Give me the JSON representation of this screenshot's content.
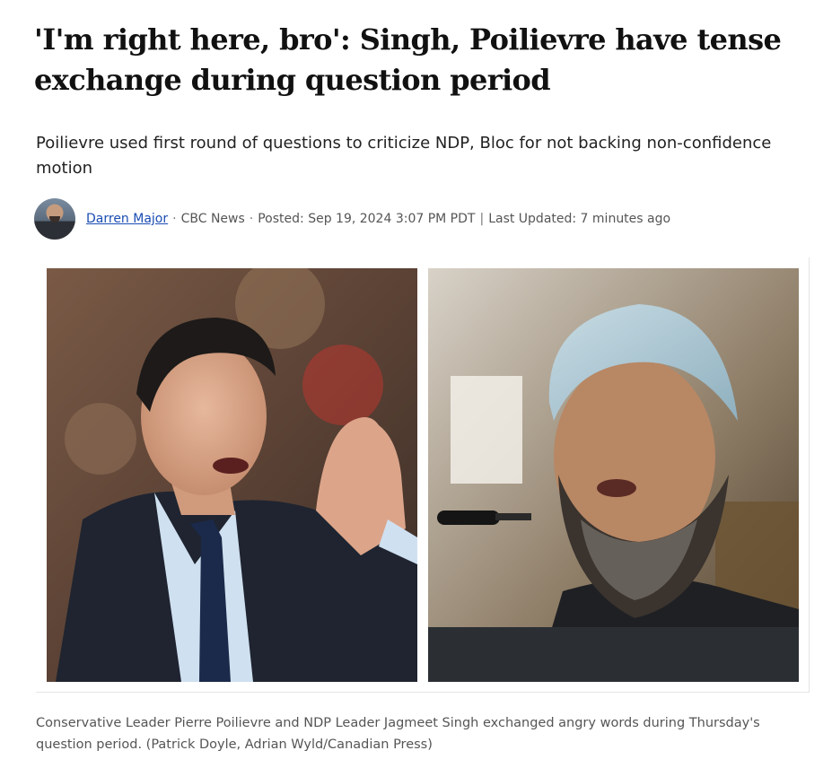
{
  "article": {
    "headline": "'I'm right here, bro': Singh, Poilievre have tense exchange during question period",
    "deck": "Poilievre used first round of questions to criticize NDP, Bloc for not backing non-confidence motion",
    "byline": {
      "author": "Darren Major",
      "outlet": "CBC News",
      "posted": "Posted: Sep 19, 2024 3:07 PM PDT",
      "divider": "|",
      "updated": "Last Updated: 7 minutes ago"
    },
    "image": {
      "left_subject": "Pierre Poilievre speaking",
      "right_subject": "Jagmeet Singh speaking"
    },
    "caption": "Conservative Leader Pierre Poilievre and NDP Leader Jagmeet Singh exchanged angry words during Thursday's question period. (Patrick Doyle, Adrian Wyld/Canadian Press)"
  }
}
